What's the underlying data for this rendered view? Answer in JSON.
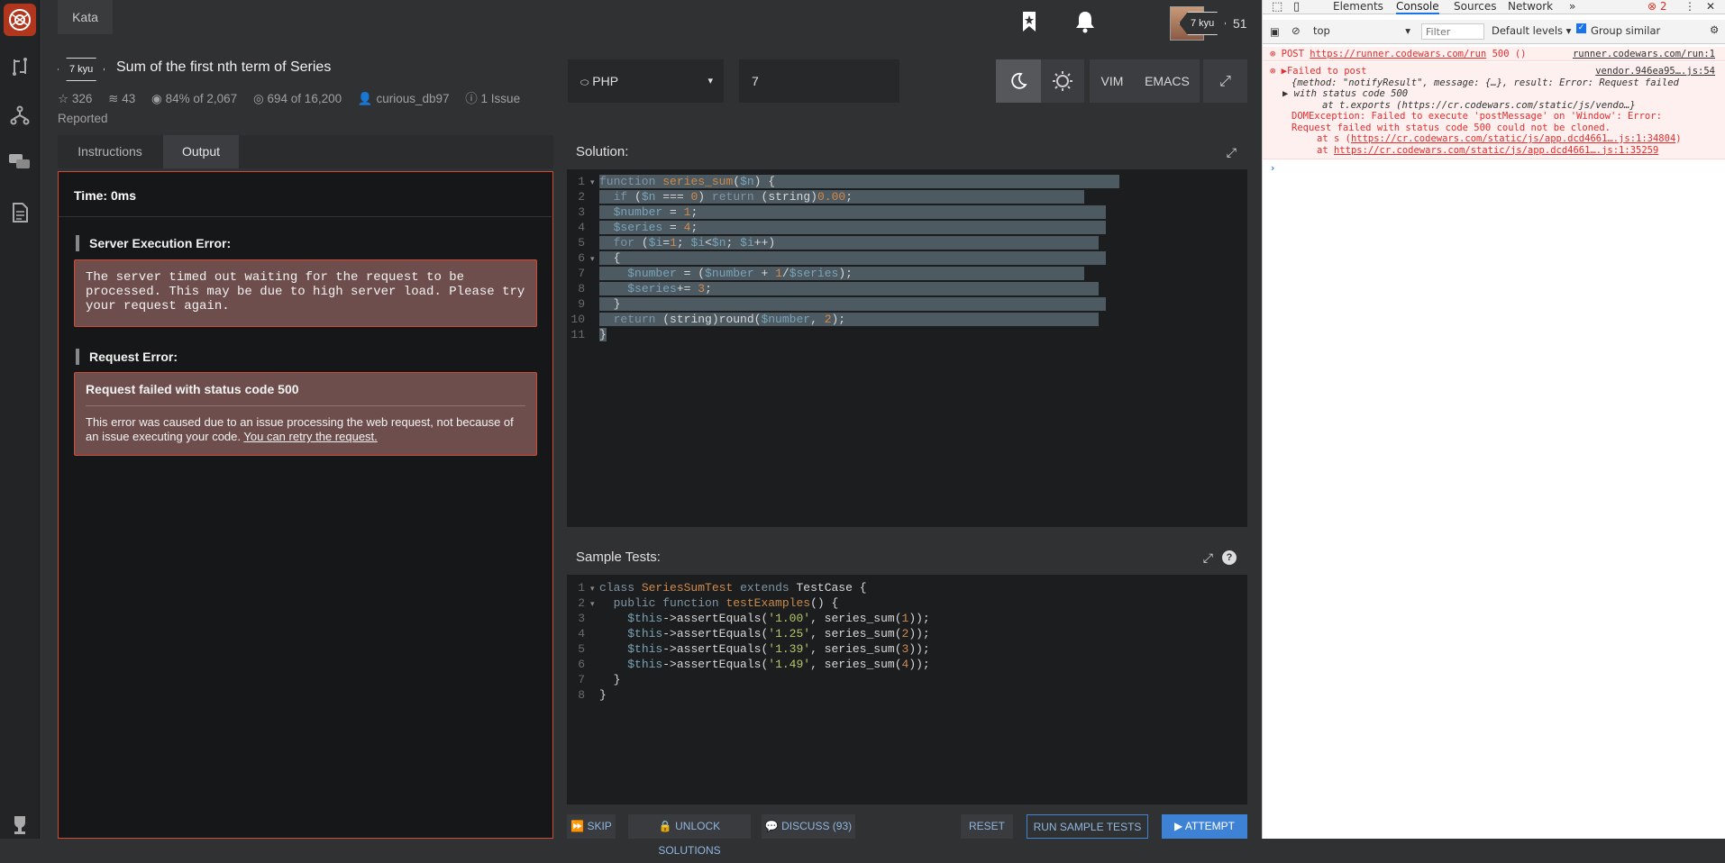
{
  "nav": {
    "kata_tab": "Kata",
    "rank": "7 kyu",
    "honor": "51"
  },
  "kata": {
    "rank": "7 kyu",
    "title": "Sum of the first nth term of Series",
    "stars": "326",
    "collections": "43",
    "satisfaction": "84%",
    "satisfaction_of": "of 2,067",
    "completed": "694",
    "completed_of": "of 16,200",
    "author": "curious_db97",
    "issues": "1 Issue",
    "reported": "Reported"
  },
  "toolbar": {
    "language": "PHP",
    "version": "7",
    "vim": "VIM",
    "emacs": "EMACS"
  },
  "tabs": {
    "instructions": "Instructions",
    "output": "Output"
  },
  "output": {
    "time": "Time: 0ms",
    "server_error_title": "Server Execution Error:",
    "server_error_msg": "The server timed out waiting for the request to be processed. This may be due to high server load. Please try your request again.",
    "request_error_title": "Request Error:",
    "request_error_heading": "Request failed with status code 500",
    "request_error_msg": "This error was caused due to an issue processing the web request, not because of an issue executing your code.",
    "retry_link": "You can retry the request."
  },
  "solution": {
    "title": "Solution:",
    "lines": [
      "function series_sum($n) {",
      "  if ($n === 0) return (string)0.00;",
      "  $number = 1;",
      "  $series = 4;",
      "  for ($i=1; $i<$n; $i++)",
      "  {",
      "    $number = ($number + 1/$series);",
      "    $series+= 3;",
      "  }",
      "  return (string)round($number, 2);",
      "}"
    ]
  },
  "tests": {
    "title": "Sample Tests:",
    "lines": [
      "class SeriesSumTest extends TestCase {",
      "  public function testExamples() {",
      "    $this->assertEquals('1.00', series_sum(1));",
      "    $this->assertEquals('1.25', series_sum(2));",
      "    $this->assertEquals('1.39', series_sum(3));",
      "    $this->assertEquals('1.49', series_sum(4));",
      "  }",
      "}"
    ]
  },
  "actions": {
    "skip": "SKIP",
    "unlock": "UNLOCK SOLUTIONS",
    "discuss": "DISCUSS (93)",
    "reset": "RESET",
    "run_tests": "RUN SAMPLE TESTS",
    "attempt": "ATTEMPT"
  },
  "devtools": {
    "tabs": [
      "Elements",
      "Console",
      "Sources",
      "Network"
    ],
    "error_count": "2",
    "context": "top",
    "filter_placeholder": "Filter",
    "levels": "Default levels",
    "group_similar": "Group similar",
    "console": {
      "l1_text": "POST",
      "l1_url": "https://runner.codewars.com/run",
      "l1_status": "500 ()",
      "l1_src": "runner.codewars.com/run:1",
      "l2_text": "Failed to post",
      "l2_src": "vendor.946ea95….js:54",
      "l3": "{method: \"notifyResult\", message: {…}, result: Error: Request failed",
      "l4": "with status code 500",
      "l5": "at t.exports (https://cr.codewars.com/static/js/vendo…}",
      "l6": "DOMException: Failed to execute 'postMessage' on 'Window': Error:",
      "l7": "Request failed with status code 500 could not be cloned.",
      "l8_pre": "at s (",
      "l8_url": "https://cr.codewars.com/static/js/app.dcd4661….js:1:34804",
      "l8_post": ")",
      "l9_pre": "at",
      "l9_url": "https://cr.codewars.com/static/js/app.dcd4661….js:1:35259"
    }
  },
  "colors": {
    "accent": "#b1361e",
    "primary_button": "#3e82d6",
    "error_border": "#d24a32"
  }
}
